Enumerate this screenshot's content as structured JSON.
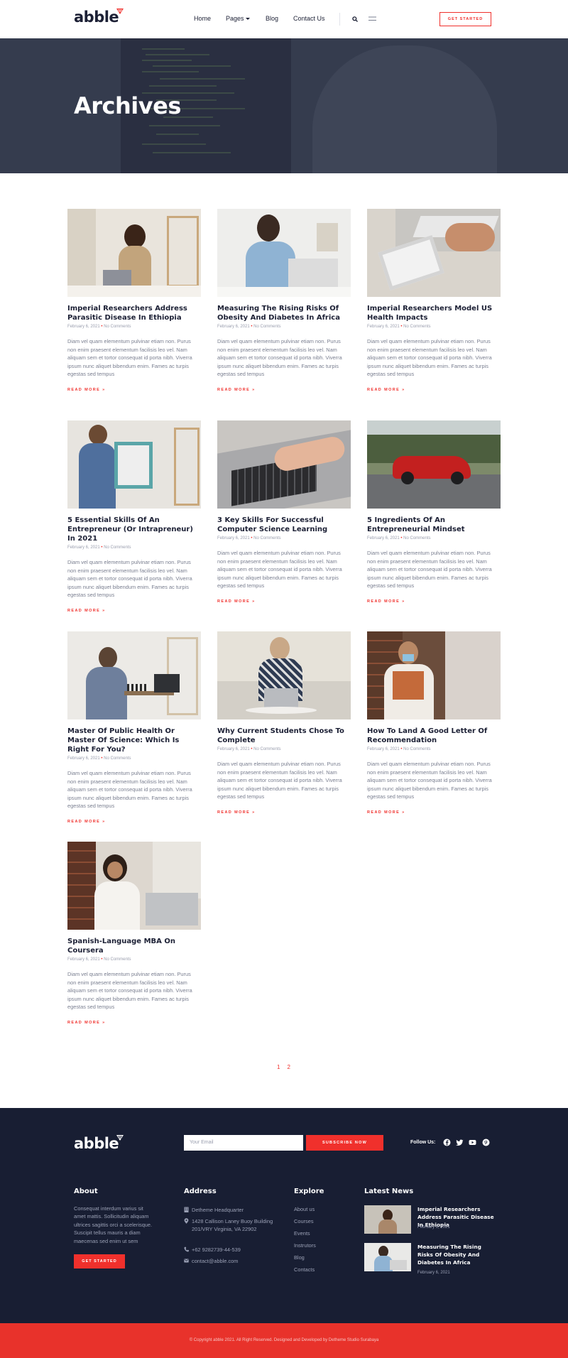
{
  "header": {
    "logo_text": "abble",
    "nav": [
      "Home",
      "Pages",
      "Blog",
      "Contact Us"
    ],
    "cta": "GET STARTED"
  },
  "hero": {
    "title": "Archives"
  },
  "posts": [
    {
      "title": "Imperial Researchers Address Parasitic Disease In Ethiopia",
      "date": "February 6, 2021",
      "comments": "No Comments",
      "excerpt": "Diam vel quam elementum pulvinar etiam non. Purus non enim praesent elementum facilisis leo vel. Nam aliquam sem et tortor consequat id porta nibh. Viverra ipsum nunc aliquet bibendum enim. Fames ac turpis egestas sed tempus",
      "more": "READ MORE »"
    },
    {
      "title": "Measuring The Rising Risks Of Obesity And Diabetes In Africa",
      "date": "February 6, 2021",
      "comments": "No Comments",
      "excerpt": "Diam vel quam elementum pulvinar etiam non. Purus non enim praesent elementum facilisis leo vel. Nam aliquam sem et tortor consequat id porta nibh. Viverra ipsum nunc aliquet bibendum enim. Fames ac turpis egestas sed tempus",
      "more": "READ MORE »"
    },
    {
      "title": "Imperial Researchers Model US Health Impacts",
      "date": "February 6, 2021",
      "comments": "No Comments",
      "excerpt": "Diam vel quam elementum pulvinar etiam non. Purus non enim praesent elementum facilisis leo vel. Nam aliquam sem et tortor consequat id porta nibh. Viverra ipsum nunc aliquet bibendum enim. Fames ac turpis egestas sed tempus",
      "more": "READ MORE »"
    },
    {
      "title": "5 Essential Skills Of An Entrepreneur (Or Intrapreneur) In 2021",
      "date": "February 6, 2021",
      "comments": "No Comments",
      "excerpt": "Diam vel quam elementum pulvinar etiam non. Purus non enim praesent elementum facilisis leo vel. Nam aliquam sem et tortor consequat id porta nibh. Viverra ipsum nunc aliquet bibendum enim. Fames ac turpis egestas sed tempus",
      "more": "READ MORE »"
    },
    {
      "title": "3 Key Skills For Successful Computer Science Learning",
      "date": "February 6, 2021",
      "comments": "No Comments",
      "excerpt": "Diam vel quam elementum pulvinar etiam non. Purus non enim praesent elementum facilisis leo vel. Nam aliquam sem et tortor consequat id porta nibh. Viverra ipsum nunc aliquet bibendum enim. Fames ac turpis egestas sed tempus",
      "more": "READ MORE »"
    },
    {
      "title": "5 Ingredients Of An Entrepreneurial Mindset",
      "date": "February 6, 2021",
      "comments": "No Comments",
      "excerpt": "Diam vel quam elementum pulvinar etiam non. Purus non enim praesent elementum facilisis leo vel. Nam aliquam sem et tortor consequat id porta nibh. Viverra ipsum nunc aliquet bibendum enim. Fames ac turpis egestas sed tempus",
      "more": "READ MORE »"
    },
    {
      "title": "Master Of Public Health Or Master Of Science: Which Is Right For You?",
      "date": "February 6, 2021",
      "comments": "No Comments",
      "excerpt": "Diam vel quam elementum pulvinar etiam non. Purus non enim praesent elementum facilisis leo vel. Nam aliquam sem et tortor consequat id porta nibh. Viverra ipsum nunc aliquet bibendum enim. Fames ac turpis egestas sed tempus",
      "more": "READ MORE »"
    },
    {
      "title": "Why Current Students Chose To Complete",
      "date": "February 6, 2021",
      "comments": "No Comments",
      "excerpt": "Diam vel quam elementum pulvinar etiam non. Purus non enim praesent elementum facilisis leo vel. Nam aliquam sem et tortor consequat id porta nibh. Viverra ipsum nunc aliquet bibendum enim. Fames ac turpis egestas sed tempus",
      "more": "READ MORE »"
    },
    {
      "title": "How To Land A Good Letter Of Recommendation",
      "date": "February 6, 2021",
      "comments": "No Comments",
      "excerpt": "Diam vel quam elementum pulvinar etiam non. Purus non enim praesent elementum facilisis leo vel. Nam aliquam sem et tortor consequat id porta nibh. Viverra ipsum nunc aliquet bibendum enim. Fames ac turpis egestas sed tempus",
      "more": "READ MORE »"
    },
    {
      "title": "Spanish-Language MBA On Coursera",
      "date": "February 6, 2021",
      "comments": "No Comments",
      "excerpt": "Diam vel quam elementum pulvinar etiam non. Purus non enim praesent elementum facilisis leo vel. Nam aliquam sem et tortor consequat id porta nibh. Viverra ipsum nunc aliquet bibendum enim. Fames ac turpis egestas sed tempus",
      "more": "READ MORE »"
    }
  ],
  "pagination": [
    "1",
    "2"
  ],
  "footer": {
    "logo_text": "abble",
    "email_placeholder": "Your Email",
    "subscribe": "SUBSCRIBE NOW",
    "follow": "Follow Us:",
    "about": {
      "title": "About",
      "text": "Consequat interdum varius sit amet mattis. Sollicitudin aliquam ultrices sagittis orci a scelerisque. Suscipit tellus mauris a diam maecenas sed enim ut sem",
      "button": "GET STARTED"
    },
    "address": {
      "title": "Address",
      "name": "Detheme Headquarter",
      "street": "1428 Callison Laney Buoy Building 201/VRY Virginia, VA 22902",
      "phone": "+62 9282739-44-539",
      "email": "contact@abble.com"
    },
    "explore": {
      "title": "Explore",
      "links": [
        "About us",
        "Courses",
        "Events",
        "Instrutors",
        "Blog",
        "Contacts"
      ]
    },
    "news": {
      "title": "Latest News",
      "items": [
        {
          "title": "Imperial Researchers Address Parasitic Disease In Ethiopia",
          "date": "February 6, 2021"
        },
        {
          "title": "Measuring The Rising Risks Of Obesity And Diabetes In Africa",
          "date": "February 6, 2021"
        }
      ]
    },
    "copyright": "© Copyright abble 2021. All Right Reserved. Designed and Developed by Detheme Studio Surabaya"
  },
  "colors": {
    "accent": "#f0302c",
    "dark": "#181e33",
    "copyright_bg": "#e8322b"
  }
}
